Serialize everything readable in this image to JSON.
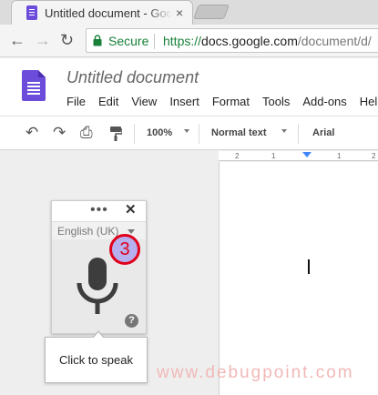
{
  "browser": {
    "tab_title": "Untitled document - Google Docs",
    "tab_close": "×",
    "nav": {
      "back": "←",
      "forward": "→",
      "reload": "↻"
    },
    "secure_label": "Secure",
    "url": {
      "scheme": "https://",
      "host": "docs.google.com",
      "path": "/document/d/"
    }
  },
  "docs": {
    "doc_title": "Untitled document",
    "menu": [
      "File",
      "Edit",
      "View",
      "Insert",
      "Format",
      "Tools",
      "Add-ons",
      "Help"
    ]
  },
  "format_toolbar": {
    "undo": "↶",
    "redo": "↷",
    "print": "⎙",
    "paint_format": "🖌",
    "zoom": "100%",
    "style": "Normal text",
    "font": "Arial"
  },
  "ruler": {
    "labels": [
      "2",
      "1",
      "1",
      "2"
    ]
  },
  "voice_typing": {
    "menu_dots": "•••",
    "close": "✕",
    "language": "English (UK)",
    "help": "?",
    "badge": "3",
    "tooltip": "Click to speak"
  },
  "watermark": "www.debugpoint.com",
  "colors": {
    "docs_purple": "#6c4cdb",
    "secure_green": "#188038",
    "badge_red": "#e0001b",
    "ruler_blue": "#4285f4"
  }
}
